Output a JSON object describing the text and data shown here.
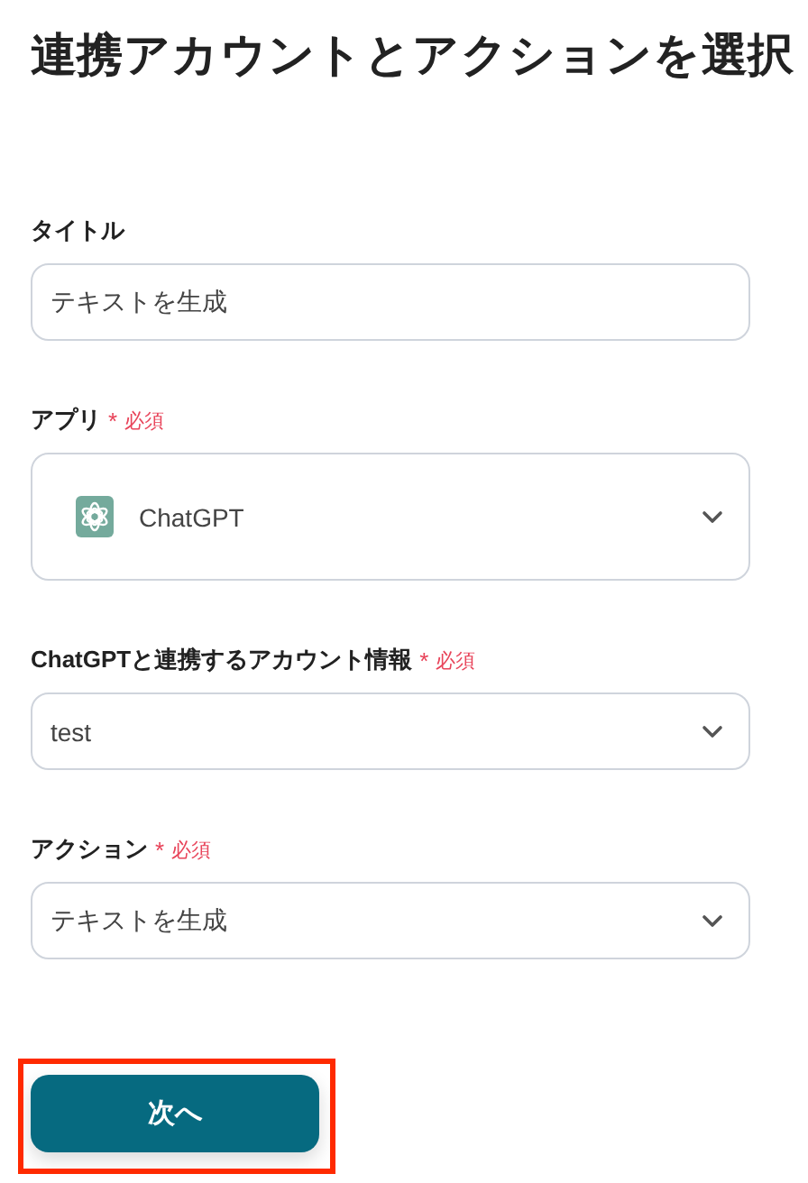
{
  "title": "連携アカウントとアクションを選択",
  "fields": [
    {
      "kind": "text",
      "label": "タイトル",
      "value": "テキストを生成"
    },
    {
      "kind": "app-select",
      "label": "アプリ",
      "required": {
        "mark": "*",
        "text": "必須"
      },
      "value": "ChatGPT"
    },
    {
      "kind": "select",
      "label": "ChatGPTと連携するアカウント情報",
      "required": {
        "mark": "*",
        "text": "必須"
      },
      "value": "test"
    },
    {
      "kind": "select",
      "label": "アクション",
      "required": {
        "mark": "*",
        "text": "必須"
      },
      "value": "テキストを生成"
    }
  ],
  "next_button": {
    "label": "次へ",
    "highlighted": true
  }
}
